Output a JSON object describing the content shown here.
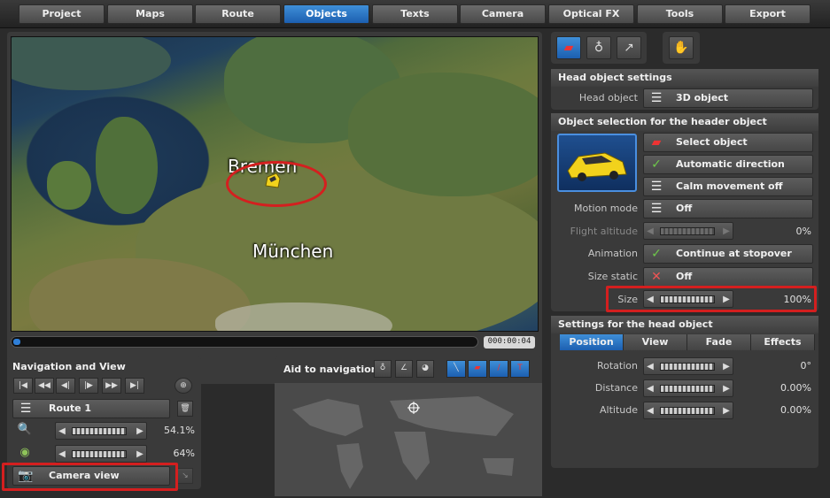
{
  "menu": {
    "items": [
      "Project",
      "Maps",
      "Route",
      "Objects",
      "Texts",
      "Camera",
      "Optical FX",
      "Tools",
      "Export"
    ],
    "active": "Objects"
  },
  "map": {
    "city_bremen": "Bremen",
    "city_muenchen": "München",
    "timecode": "000:00:04"
  },
  "navigation": {
    "title": "Navigation and View",
    "route_label": "Route 1",
    "zoom_value": "54.1%",
    "tilt_value": "64%",
    "camera_view_label": "Camera view"
  },
  "aid": {
    "title": "Aid to navigation"
  },
  "head_object": {
    "title": "Head object settings",
    "head_object_label": "Head object",
    "head_object_value": "3D object"
  },
  "selection": {
    "title": "Object selection for the header object",
    "select_object": "Select object",
    "automatic_direction": "Automatic direction",
    "calm_movement": "Calm movement off",
    "motion_mode_label": "Motion mode",
    "motion_mode_value": "Off",
    "flight_altitude_label": "Flight altitude",
    "flight_altitude_value": "0%",
    "animation_label": "Animation",
    "animation_value": "Continue at stopover",
    "size_static_label": "Size static",
    "size_static_value": "Off",
    "size_label": "Size",
    "size_value": "100%"
  },
  "head_settings": {
    "title": "Settings for the head object",
    "tabs": [
      "Position",
      "View",
      "Fade",
      "Effects"
    ],
    "active_tab": "Position",
    "rotation_label": "Rotation",
    "rotation_value": "0°",
    "distance_label": "Distance",
    "distance_value": "0.00%",
    "altitude_label": "Altitude",
    "altitude_value": "0.00%"
  },
  "colors": {
    "accent": "#2f7fd8",
    "highlight_red": "#d41f1f"
  }
}
